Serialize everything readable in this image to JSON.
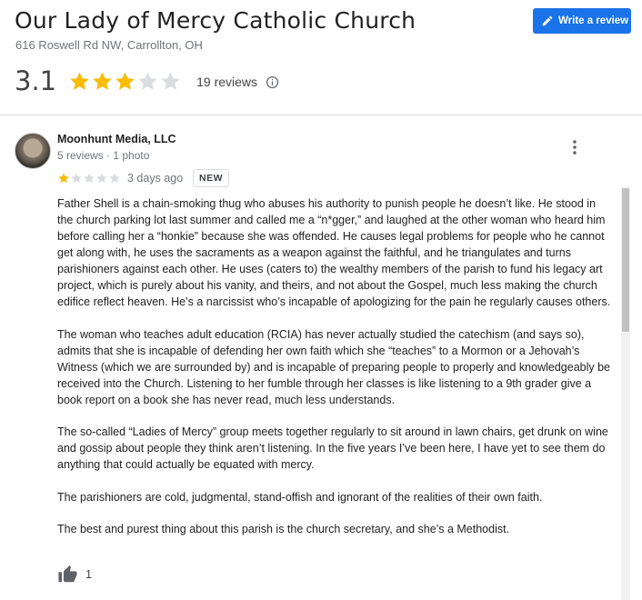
{
  "place": {
    "name": "Our Lady of Mercy Catholic Church",
    "address": "616 Roswell Rd NW, Carrollton, OH"
  },
  "actions": {
    "write_review_label": "Write a review"
  },
  "summary": {
    "average_rating": "3.1",
    "stars_filled": 3.1,
    "stars_total": 5,
    "review_count_label": "19 reviews"
  },
  "review": {
    "author": "Moonhunt Media, LLC",
    "author_meta": "5 reviews · 1 photo",
    "rating": 1,
    "date": "3 days ago",
    "badge": "NEW",
    "paragraphs": [
      "Father Shell is a chain-smoking thug who abuses his authority to punish people he doesn’t like. He stood in the church parking lot last summer and called me a “n*gger,” and laughed at the other woman who heard him before calling her a “honkie” because she was offended. He causes legal problems for people who he cannot get along with, he uses the sacraments as a weapon against the faithful, and he triangulates and turns parishioners against each other. He uses (caters to) the wealthy members of the parish to fund his legacy art project, which is purely about his vanity, and theirs, and not about the Gospel, much less making the church edifice reflect heaven. He’s a narcissist who’s incapable of apologizing for the pain he regularly causes others.",
      "The woman who teaches adult education (RCIA) has never actually studied the catechism (and says so), admits that she is incapable of defending her own faith which she “teaches” to a Mormon or a Jehovah’s Witness (which we are surrounded by) and is incapable of preparing people to properly and knowledgeably be received into the Church. Listening to her fumble through her classes is like listening to a 9th grader give a book report on a book she has never read, much less understands.",
      "The so-called “Ladies of Mercy” group meets together regularly to sit around in lawn chairs, get drunk on wine and gossip about people they think aren’t listening. In the five years I’ve been here, I have yet to see them do anything that could actually be equated with mercy.",
      "The parishioners are cold, judgmental, stand-offish and ignorant of the realities of their own faith.",
      "The best and purest thing about this parish is the church secretary, and she’s a Methodist."
    ],
    "likes": "1"
  },
  "icons": {
    "write_review": "pencil-icon",
    "info": "info-icon",
    "more": "more-vertical-icon",
    "like": "thumbs-up-icon",
    "star": "star-icon"
  },
  "colors": {
    "star_filled": "#fbbc04",
    "star_empty": "#dadce0",
    "accent": "#1a73e8"
  }
}
